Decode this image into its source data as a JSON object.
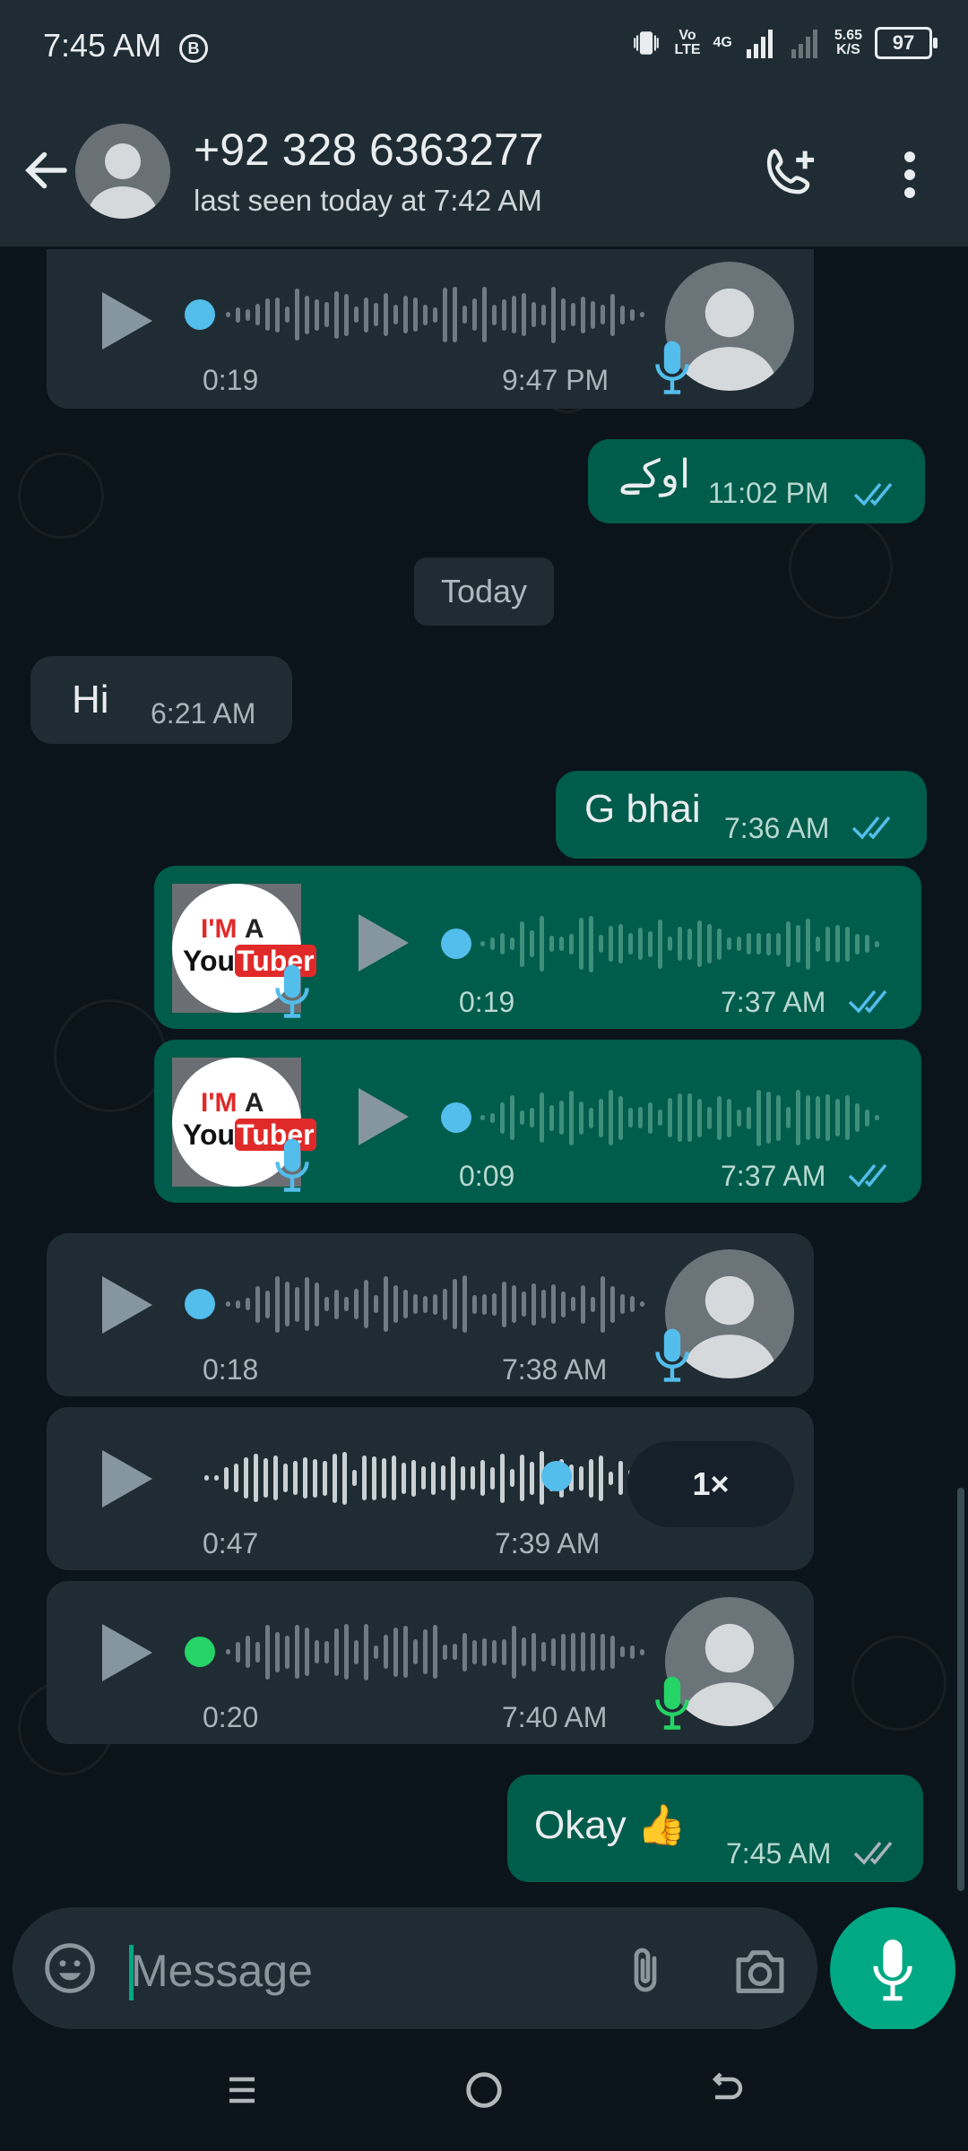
{
  "status_bar": {
    "time": "7:45 AM",
    "carrier_badge": "B",
    "volte_top": "Vo",
    "volte_bottom": "LTE",
    "network": "4G",
    "speed_top": "5.65",
    "speed_bottom": "K/S",
    "battery": "97"
  },
  "header": {
    "contact": "+92 328 6363277",
    "last_seen": "last seen today at 7:42 AM"
  },
  "messages": {
    "m1": {
      "duration": "0:19",
      "time": "9:47 PM"
    },
    "m2": {
      "text": "اوکے",
      "time": "11:02 PM"
    },
    "day": "Today",
    "m3": {
      "text": "Hi",
      "time": "6:21 AM"
    },
    "m4": {
      "text": "G bhai",
      "time": "7:36 AM"
    },
    "m5": {
      "duration": "0:19",
      "time": "7:37 AM",
      "thumb_line1_red": "I'M",
      "thumb_line1_dark": "A",
      "thumb_line2_dark": "You",
      "thumb_line2_red": "Tuber"
    },
    "m6": {
      "duration": "0:09",
      "time": "7:37 AM",
      "thumb_line1_red": "I'M",
      "thumb_line1_dark": "A",
      "thumb_line2_dark": "You",
      "thumb_line2_red": "Tuber"
    },
    "m7": {
      "duration": "0:18",
      "time": "7:38 AM"
    },
    "m8": {
      "duration": "0:47",
      "time": "7:39 AM",
      "speed": "1×"
    },
    "m9": {
      "duration": "0:20",
      "time": "7:40 AM"
    },
    "m10": {
      "text": "Okay 👍",
      "time": "7:45 AM"
    }
  },
  "input": {
    "placeholder": "Message"
  },
  "colors": {
    "accent": "#00a884",
    "outgoing_bubble": "#005c4b",
    "incoming_bubble": "#202c33",
    "read_ticks": "#53bdeb",
    "header_bg": "#1f2c34"
  },
  "icons": [
    "back-arrow-icon",
    "avatar-icon",
    "add-call-icon",
    "more-vert-icon",
    "play-icon",
    "mic-icon",
    "double-check-icon",
    "emoji-icon",
    "attach-icon",
    "camera-icon",
    "menu-nav-icon",
    "home-nav-icon",
    "back-nav-icon"
  ]
}
